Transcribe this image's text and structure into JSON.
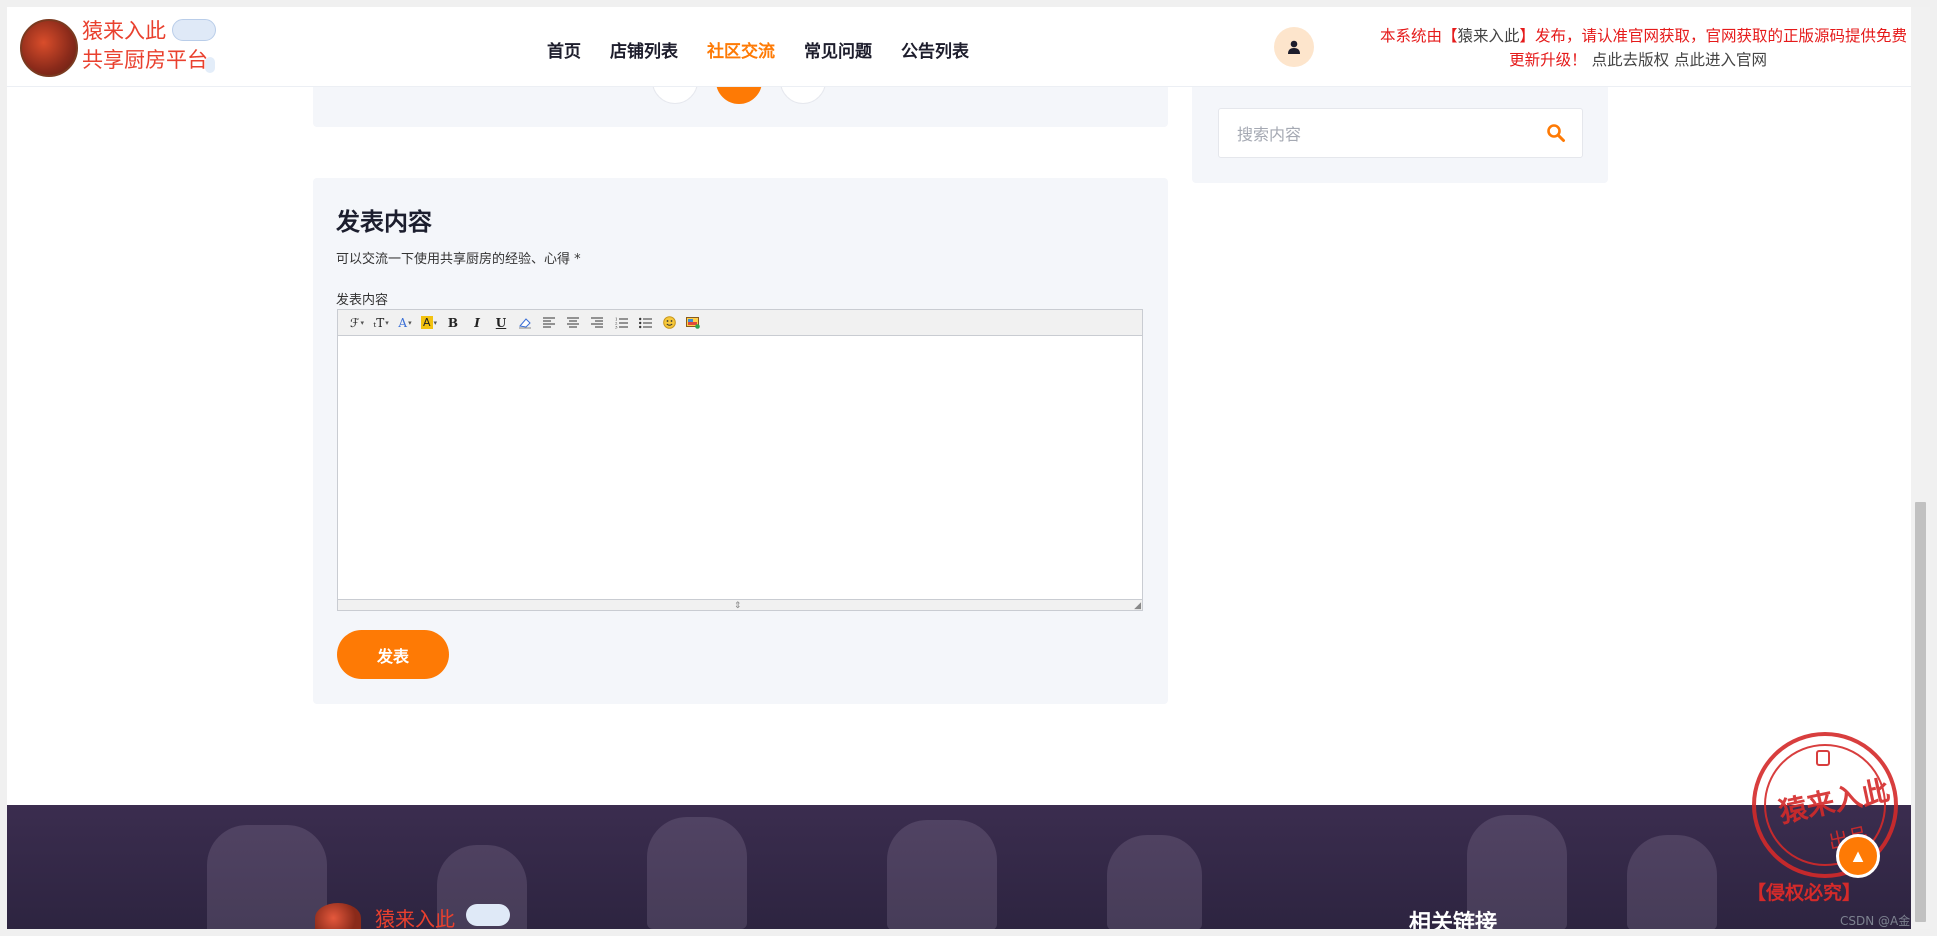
{
  "header": {
    "logo_line1": "猿来入此",
    "logo_line2": "共享厨房平台",
    "nav": [
      "首页",
      "店铺列表",
      "社区交流",
      "常见问题",
      "公告列表"
    ],
    "active_nav": "社区交流",
    "notice_red1": "本系统由【",
    "notice_dark1": "猿来入此",
    "notice_red2": "】发布，请认准官网获取，官网获取的正版源码提供免费",
    "notice_red3": "更新升级！",
    "notice_dark2": "点此去版权 点此进入官网"
  },
  "sidebar": {
    "search_placeholder": "搜索内容"
  },
  "post": {
    "title": "发表内容",
    "subtitle": "可以交流一下使用共享厨房的经验、心得 *",
    "editor_label": "发表内容",
    "toolbar": [
      "ℱ",
      "ₜT",
      "A",
      "A",
      "B",
      "I",
      "U",
      "⌫",
      "≡",
      "≡",
      "≡",
      "⒈",
      "•",
      "☺",
      "▦"
    ],
    "submit_label": "发表"
  },
  "footer": {
    "logo_text": "猿来入此",
    "heading": "相关链接"
  },
  "stamp": {
    "text": "猿来入此",
    "small": "出品",
    "caption": "【侵权必究】"
  },
  "watermark": "CSDN @A金"
}
